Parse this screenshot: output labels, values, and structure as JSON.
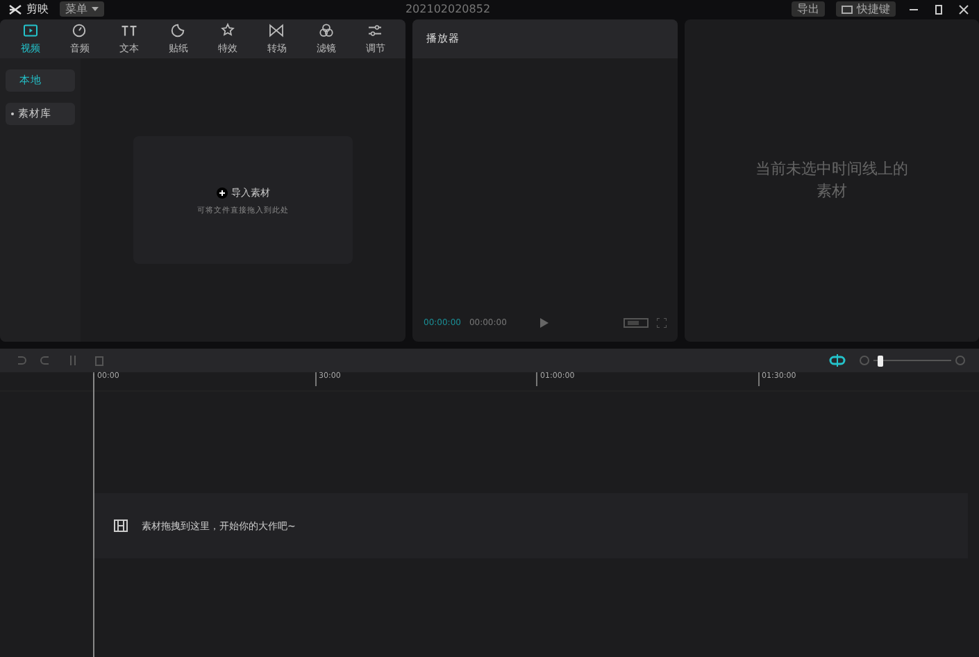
{
  "app": {
    "name": "剪映",
    "menu": "菜单",
    "project_title": "202102020852",
    "export": "导出",
    "shortcuts": "快捷键"
  },
  "media_tabs": [
    {
      "label": "视频",
      "selected": true
    },
    {
      "label": "音频",
      "selected": false
    },
    {
      "label": "文本",
      "selected": false
    },
    {
      "label": "贴纸",
      "selected": false
    },
    {
      "label": "特效",
      "selected": false
    },
    {
      "label": "转场",
      "selected": false
    },
    {
      "label": "滤镜",
      "selected": false
    },
    {
      "label": "调节",
      "selected": false
    }
  ],
  "sidebar": {
    "items": [
      {
        "label": "本地",
        "selected": true
      },
      {
        "label": "素材库",
        "selected": false
      }
    ]
  },
  "import": {
    "label": "导入素材",
    "hint": "可将文件直接拖入到此处"
  },
  "player": {
    "title": "播放器",
    "current_time": "00:00:00",
    "total_time": "00:00:00"
  },
  "inspector": {
    "empty_text": "当前未选中时间线上的素材"
  },
  "timeline": {
    "zoom": {
      "level": 0.05
    },
    "ruler": [
      "00:00",
      "30:00",
      "01:00:00",
      "01:30:00"
    ],
    "drop_hint": "素材拖拽到这里，开始你的大作吧~"
  }
}
